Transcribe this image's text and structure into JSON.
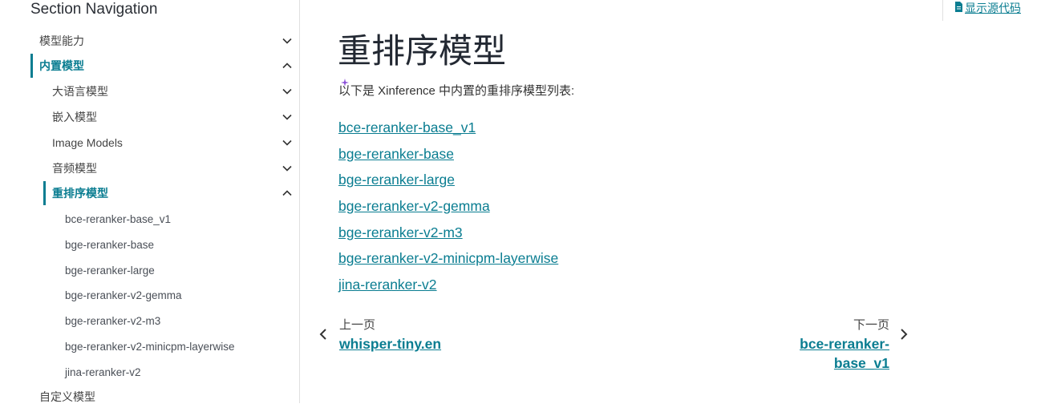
{
  "sidebar": {
    "title": "Section Navigation",
    "items": [
      {
        "label": "模型能力",
        "level": 1,
        "expanded": false,
        "active": false
      },
      {
        "label": "内置模型",
        "level": 1,
        "expanded": true,
        "active": true
      },
      {
        "label": "大语言模型",
        "level": 2,
        "expanded": false,
        "active": false
      },
      {
        "label": "嵌入模型",
        "level": 2,
        "expanded": false,
        "active": false
      },
      {
        "label": "Image Models",
        "level": 2,
        "expanded": false,
        "active": false
      },
      {
        "label": "音频模型",
        "level": 2,
        "expanded": false,
        "active": false
      },
      {
        "label": "重排序模型",
        "level": 2,
        "expanded": true,
        "active": true
      },
      {
        "label": "bce-reranker-base_v1",
        "level": 3
      },
      {
        "label": "bge-reranker-base",
        "level": 3
      },
      {
        "label": "bge-reranker-large",
        "level": 3
      },
      {
        "label": "bge-reranker-v2-gemma",
        "level": 3
      },
      {
        "label": "bge-reranker-v2-m3",
        "level": 3
      },
      {
        "label": "bge-reranker-v2-minicpm-layerwise",
        "level": 3
      },
      {
        "label": "jina-reranker-v2",
        "level": 3
      },
      {
        "label": "自定义模型",
        "level": 1
      }
    ]
  },
  "header": {
    "source_link": "显示源代码"
  },
  "main": {
    "title": "重排序模型",
    "intro": "以下是 Xinference 中内置的重排序模型列表:",
    "models": [
      "bce-reranker-base_v1",
      "bge-reranker-base",
      "bge-reranker-large",
      "bge-reranker-v2-gemma",
      "bge-reranker-v2-m3",
      "bge-reranker-v2-minicpm-layerwise",
      "jina-reranker-v2"
    ]
  },
  "pager": {
    "prev_label": "上一页",
    "prev_title": "whisper-tiny.en",
    "next_label": "下一页",
    "next_title": "bce-reranker-base_v1"
  },
  "colors": {
    "accent": "#0a7d91",
    "sparkle": "#8a4fd8"
  }
}
